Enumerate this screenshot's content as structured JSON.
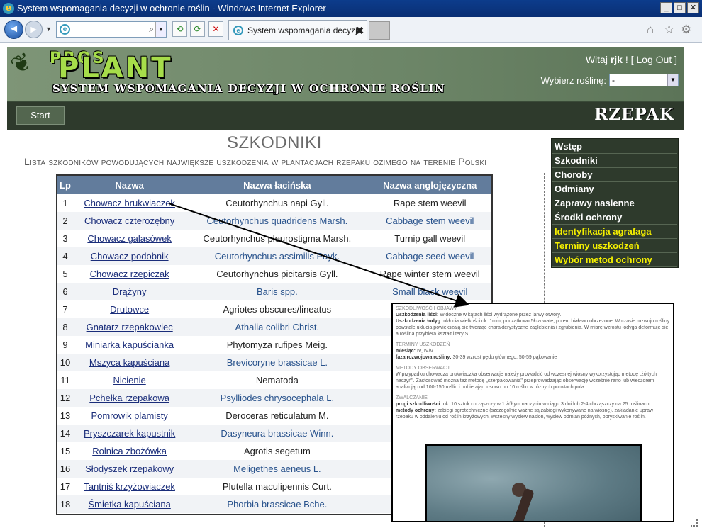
{
  "window": {
    "title": "System wspomagania decyzji w ochronie roślin - Windows Internet Explorer",
    "min": "_",
    "max": "□",
    "close": "✕"
  },
  "browser": {
    "tab_label": "System wspomagania decyzj...",
    "tab_close": "✖",
    "back": "◄",
    "forward": "►",
    "search_icon": "⌕",
    "dd": "▼",
    "refresh": "⟳",
    "stop": "✕",
    "compat": "⟲",
    "home": "⌂",
    "favorites": "☆",
    "tools": "⚙",
    "ie_letter": "e"
  },
  "site": {
    "logo_pros": "PROS",
    "logo_plant": "PLANT",
    "logo_sub": "SYSTEM WSPOMAGANIA DECYZJI W OCHRONIE ROŚLIN",
    "welcome_prefix": "Witaj ",
    "user": "rjk",
    "welcome_mid": " ! [ ",
    "logout": "Log Out",
    "welcome_suffix": " ]",
    "choose_label": "Wybierz roślinę:",
    "choose_value": "-",
    "start": "Start",
    "crop": "RZEPAK"
  },
  "main": {
    "title": "SZKODNIKI",
    "subtitle": "Lista szkodników powodujących największe uszkodzenia w plantacjach rzepaku ozimego na terenie Polski",
    "columns": [
      "Lp",
      "Nazwa",
      "Nazwa łacińska",
      "Nazwa anglojęzyczna"
    ],
    "rows": [
      [
        "1",
        "Chowacz brukwiaczek",
        "Ceutorhynchus napi Gyll.",
        "Rape stem weevil"
      ],
      [
        "2",
        "Chowacz czterozębny",
        "Ceutorhynchus quadridens Marsh.",
        "Cabbage stem weevil"
      ],
      [
        "3",
        "Chowacz galasówek",
        "Ceutorhynchus pleurostigma Marsh.",
        "Turnip gall weevil"
      ],
      [
        "4",
        "Chowacz podobnik",
        "Ceutorhynchus assimilis Payk.",
        "Cabbage seed weevil"
      ],
      [
        "5",
        "Chowacz rzepiczak",
        "Ceutorhynchus picitarsis Gyll.",
        "Rape winter stem weevil"
      ],
      [
        "6",
        "Drążyny",
        "Baris spp.",
        "Small black weevil"
      ],
      [
        "7",
        "Drutowce",
        "Agriotes obscures/lineatus",
        "Click beetle, S"
      ],
      [
        "8",
        "Gnatarz rzepakowiec",
        "Athalia colibri Christ.",
        "Cole"
      ],
      [
        "9",
        "Miniarka kapuścianka",
        "Phytomyza rufipes Meig.",
        "Cabba"
      ],
      [
        "10",
        "Mszyca kapuściana",
        "Brevicoryne brassicae L.",
        "Cab"
      ],
      [
        "11",
        "Nicienie",
        "Nematoda",
        "Rot"
      ],
      [
        "12",
        "Pchełka rzepakowa",
        "Psylliodes chrysocephala L.",
        "Cabbage"
      ],
      [
        "13",
        "Pomrowik plamisty",
        "Deroceras reticulatum M.",
        "Loach,"
      ],
      [
        "14",
        "Pryszczarek kapustnik",
        "Dasyneura brassicae Winn.",
        "Brassic"
      ],
      [
        "15",
        "Rolnica zbożówka",
        "Agrotis segetum",
        "Turnip moth, B"
      ],
      [
        "16",
        "Słodyszek rzepakowy",
        "Meligethes aeneus L.",
        "Pollen beetle, Blos"
      ],
      [
        "17",
        "Tantniś krzyżowiaczek",
        "Plutella maculipennis Curt.",
        "Diamo"
      ],
      [
        "18",
        "Śmietka kapuściana",
        "Phorbia brassicae Bche.",
        "Ca"
      ]
    ]
  },
  "sidebar": {
    "items": [
      {
        "label": "Wstęp",
        "hl": false
      },
      {
        "label": "Szkodniki",
        "hl": false
      },
      {
        "label": "Choroby",
        "hl": false
      },
      {
        "label": "Odmiany",
        "hl": false
      },
      {
        "label": "Zaprawy nasienne",
        "hl": false
      },
      {
        "label": "Środki ochrony",
        "hl": false
      },
      {
        "label": "Identyfikacja agrafaga",
        "hl": true
      },
      {
        "label": "Terminy uszkodzeń",
        "hl": true
      },
      {
        "label": "Wybór metod ochrony",
        "hl": true
      }
    ]
  },
  "popup": {
    "sec1": "Szkodliwość i objawy",
    "p1_label": "Uszkodzenia liści:",
    "p1": " Widoczne w kątach liści wydrążone przez larwy otwory.",
    "p2_label": "Uszkodzenia łodyg:",
    "p2": " ukłucia wielkości ok. 1mm, początkowo 5łuzowate, potem białawo obrzeżone. W czasie rozwoju rośliny powstałe ukłucia powiększają się tworząc charakterystyczne zagłębienia i zgrubienia. W miarę wzrostu łodyga deformuje się, a roślina przybiera kształt litery S.",
    "sec2": "Terminy uszkodzeń",
    "p3_label": "miesiąc:",
    "p3": " IV, IV/V",
    "p4_label": "faza rozwojowa rośliny:",
    "p4": " 30-39 wzrost pędu głównego, 50-59 pąkowanie",
    "sec3": "Metody obserwacji",
    "p5": "W przypadku chowacza brukwiaczka obserwacje należy prowadzić od wczesnej wiosny wykorzystując metodę „żółtych naczyń\". Zastosować można też metodę „czerpakowania\" przeprowadzając obserwację wcześnie rano lub wieczorem analizując od 100-150 roślin i pobierając losowo po 10 roślin w różnych punktach pola.",
    "sec4": "Zwalczanie",
    "p6_label": "progi szkodliwości:",
    "p6": " ok. 10 sztuk chrząszczy w 1 żółtym naczyniu w ciągu 3 dni lub 2-4 chrząszczy na 25 roślinach.",
    "p7_label": "metody ochrony:",
    "p7": " zabiegi agrotechniczne (szczególnie ważne są zabiegi wykonywane na wiosnę), zakładanie upraw rzepaku w oddaleniu od roślin krzyżowych, wczesny wysiew nasion, wysiew odmian późnych, opryskiwanie roślin."
  }
}
